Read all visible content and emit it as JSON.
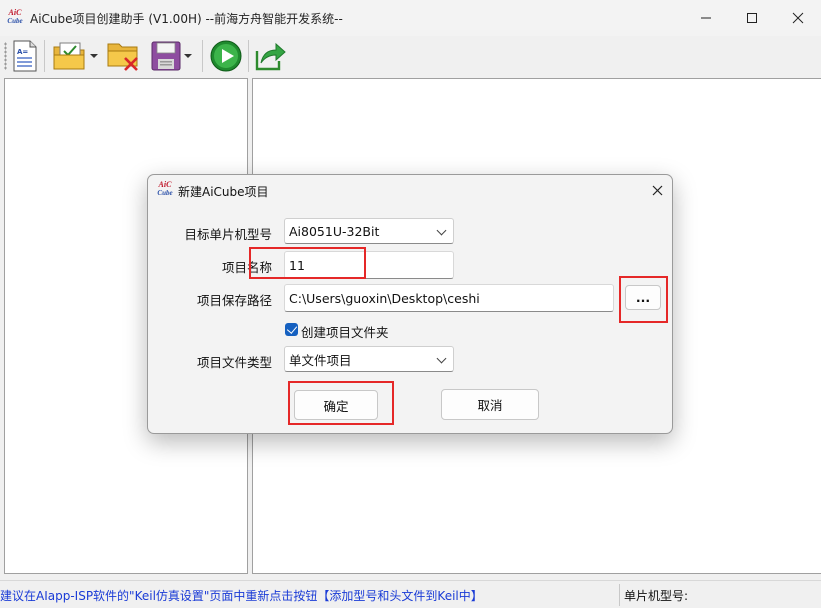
{
  "window": {
    "title": "AiCube项目创建助手 (V1.00H) --前海方舟智能开发系统--",
    "logo_line1": "AiC",
    "logo_line2": "Cube"
  },
  "toolbar": {
    "icons": [
      "new-file-icon",
      "open-project-icon",
      "delete-project-icon",
      "save-icon",
      "run-icon",
      "export-icon"
    ]
  },
  "dialog": {
    "title": "新建AiCube项目",
    "logo_line1": "AiC",
    "logo_line2": "Cube",
    "mcu_label": "目标单片机型号",
    "mcu_value": "Ai8051U-32Bit",
    "name_label": "项目名称",
    "name_value": "11",
    "path_label": "项目保存路径",
    "path_value": "C:\\Users\\guoxin\\Desktop\\ceshi",
    "browse_label": "...",
    "create_folder_label": "创建项目文件夹",
    "create_folder_checked": true,
    "type_label": "项目文件类型",
    "type_value": "单文件项目",
    "ok_label": "确定",
    "cancel_label": "取消"
  },
  "statusbar": {
    "message": "建议在AIapp-ISP软件的\"Keil仿真设置\"页面中重新点击按钮【添加型号和头文件到Keil中】",
    "chip_label": "单片机型号:"
  },
  "colors": {
    "highlight": "#e52828",
    "status_text": "#1a3bd6",
    "checkbox": "#1560c0"
  }
}
